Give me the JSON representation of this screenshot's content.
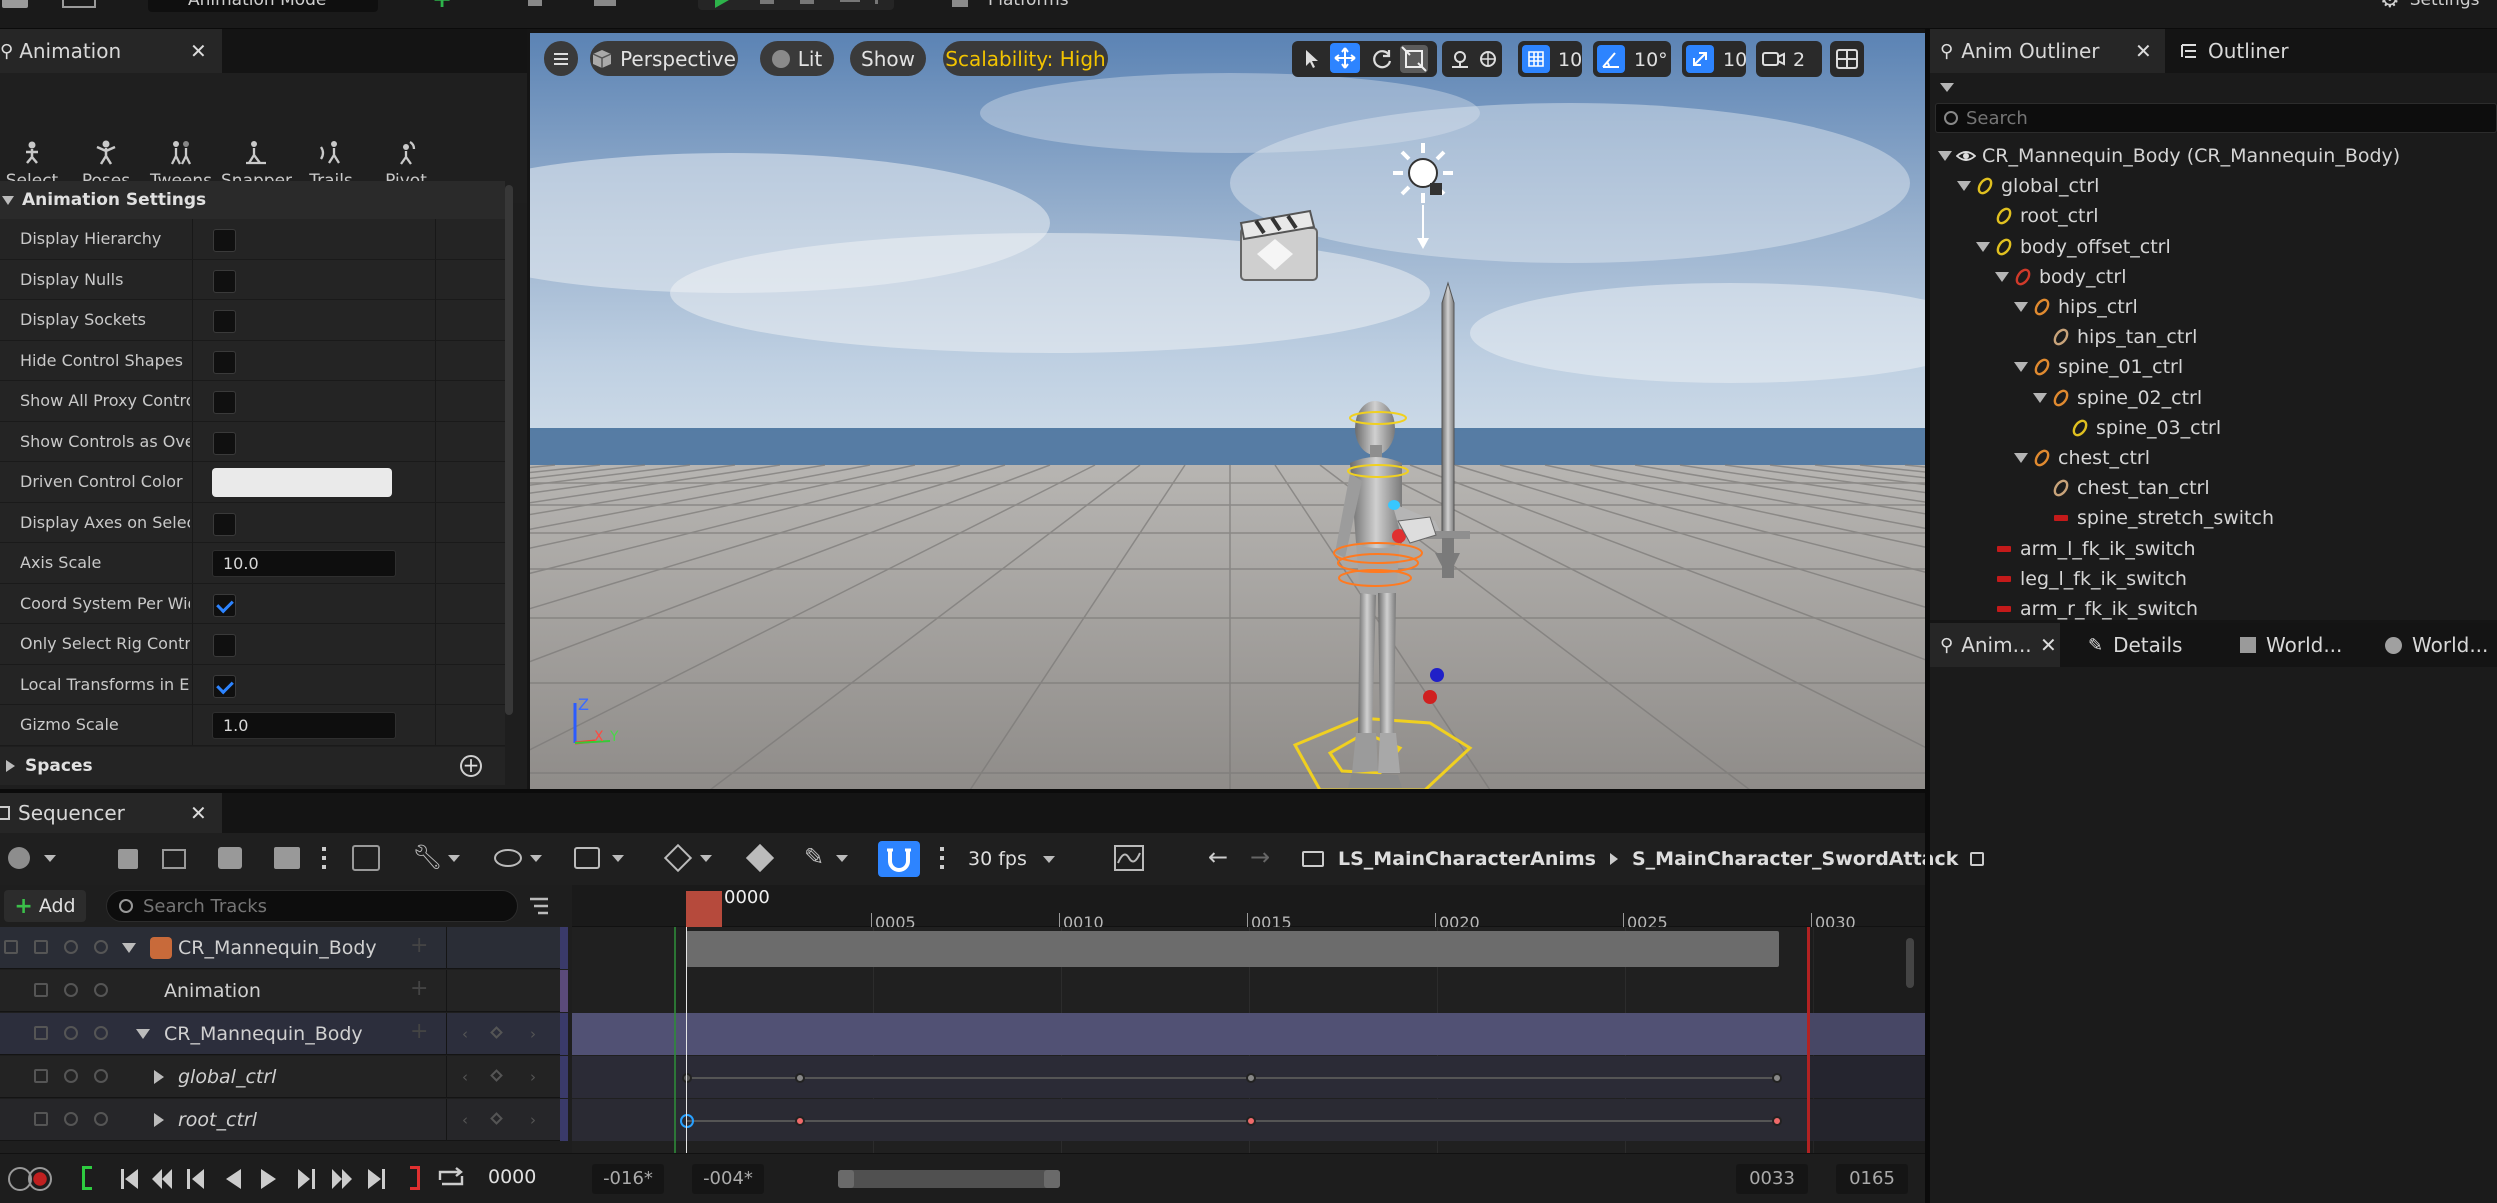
{
  "top_bar": {
    "mode_dropdown_label": "Animation Mode",
    "platforms_label": "Platforms",
    "settings_label": "Settings"
  },
  "animation_panel": {
    "tab_label": "Animation",
    "tools": [
      "Select",
      "Poses",
      "Tweens",
      "Snapper",
      "Trails",
      "Pivot"
    ],
    "section_title": "Animation Settings",
    "settings": [
      {
        "label": "Display Hierarchy",
        "type": "checkbox",
        "checked": false
      },
      {
        "label": "Display Nulls",
        "type": "checkbox",
        "checked": false
      },
      {
        "label": "Display Sockets",
        "type": "checkbox",
        "checked": false
      },
      {
        "label": "Hide Control Shapes",
        "type": "checkbox",
        "checked": false
      },
      {
        "label": "Show All Proxy Controls",
        "type": "checkbox",
        "checked": false
      },
      {
        "label": "Show Controls as Ove...",
        "type": "checkbox",
        "checked": false
      },
      {
        "label": "Driven Control Color",
        "type": "color",
        "value": "#eaeaea"
      },
      {
        "label": "Display Axes on Selec...",
        "type": "checkbox",
        "checked": false
      },
      {
        "label": "Axis Scale",
        "type": "number",
        "value": "10.0"
      },
      {
        "label": "Coord System Per Wid...",
        "type": "checkbox",
        "checked": true
      },
      {
        "label": "Only Select Rig Controls",
        "type": "checkbox",
        "checked": false
      },
      {
        "label": "Local Transforms in E...",
        "type": "checkbox",
        "checked": true
      },
      {
        "label": "Gizmo Scale",
        "type": "number",
        "value": "1.0"
      }
    ],
    "spaces_label": "Spaces"
  },
  "viewport": {
    "perspective_label": "Perspective",
    "lit_label": "Lit",
    "show_label": "Show",
    "scalability_label": "Scalability: High",
    "grid_snap_value": "10",
    "rotation_snap_value": "10°",
    "scale_snap_value": "10",
    "camera_speed_value": "2",
    "axis_z": "Z",
    "axis_x": "X",
    "axis_y": "Y"
  },
  "outliner": {
    "tab_anim_outliner": "Anim Outliner",
    "tab_outliner": "Outliner",
    "search_placeholder": "Search",
    "items": [
      {
        "label": "CR_Mannequin_Body  (CR_Mannequin_Body)",
        "icon": "eye-icon",
        "depth": 0,
        "expanded": true
      },
      {
        "label": "global_ctrl",
        "icon": "yellow",
        "depth": 1,
        "expanded": true
      },
      {
        "label": "root_ctrl",
        "icon": "yellow",
        "depth": 2,
        "expanded": false
      },
      {
        "label": "body_offset_ctrl",
        "icon": "yellow",
        "depth": 2,
        "expanded": true
      },
      {
        "label": "body_ctrl",
        "icon": "red",
        "depth": 3,
        "expanded": true
      },
      {
        "label": "hips_ctrl",
        "icon": "orange",
        "depth": 4,
        "expanded": true
      },
      {
        "label": "hips_tan_ctrl",
        "icon": "tan",
        "depth": 5,
        "expanded": false
      },
      {
        "label": "spine_01_ctrl",
        "icon": "orange",
        "depth": 4,
        "expanded": true
      },
      {
        "label": "spine_02_ctrl",
        "icon": "orange",
        "depth": 5,
        "expanded": true
      },
      {
        "label": "spine_03_ctrl",
        "icon": "yellow",
        "depth": 6,
        "expanded": false
      },
      {
        "label": "chest_ctrl",
        "icon": "orange",
        "depth": 4,
        "expanded": true
      },
      {
        "label": "chest_tan_ctrl",
        "icon": "tan",
        "depth": 5,
        "expanded": false
      },
      {
        "label": "spine_stretch_switch",
        "icon": "switch",
        "depth": 5,
        "expanded": false
      },
      {
        "label": "arm_l_fk_ik_switch",
        "icon": "switch",
        "depth": 2,
        "expanded": false
      },
      {
        "label": "leg_l_fk_ik_switch",
        "icon": "switch",
        "depth": 2,
        "expanded": false
      },
      {
        "label": "arm_r_fk_ik_switch",
        "icon": "switch",
        "depth": 2,
        "expanded": false
      }
    ]
  },
  "details_tabs": {
    "anim_label": "Anim...",
    "details_label": "Details",
    "world1_label": "World...",
    "world2_label": "World..."
  },
  "sequencer": {
    "tab_label": "Sequencer",
    "fps_label": "30 fps",
    "breadcrumb_parent": "LS_MainCharacterAnims",
    "breadcrumb_current": "S_MainCharacter_SwordAttack",
    "add_label": "Add",
    "search_placeholder": "Search Tracks",
    "playhead_frame": "0000",
    "ruler_labels": [
      "0005",
      "0010",
      "0015",
      "0020",
      "0025",
      "0030"
    ],
    "tracks": [
      {
        "label": "CR_Mannequin_Body",
        "indent": 1,
        "expander": "down",
        "icon": "skeletal-mesh-icon"
      },
      {
        "label": "Animation",
        "indent": 2,
        "expander": "none"
      },
      {
        "label": "CR_Mannequin_Body",
        "indent": 2,
        "expander": "down"
      },
      {
        "label": "global_ctrl",
        "indent": 3,
        "expander": "right"
      },
      {
        "label": "root_ctrl",
        "indent": 3,
        "expander": "right"
      }
    ],
    "keyframes_frames": [
      0,
      3,
      15,
      29
    ],
    "current_time": "0000",
    "view_start": "-016*",
    "working_start": "-004*",
    "playback_end": "0033",
    "view_end": "0165"
  },
  "colors": {
    "accent_blue": "#2d84ff",
    "scalability_yellow": "#f2c300",
    "playhead_red": "#b64a3c",
    "key_red": "#f06a6a"
  }
}
